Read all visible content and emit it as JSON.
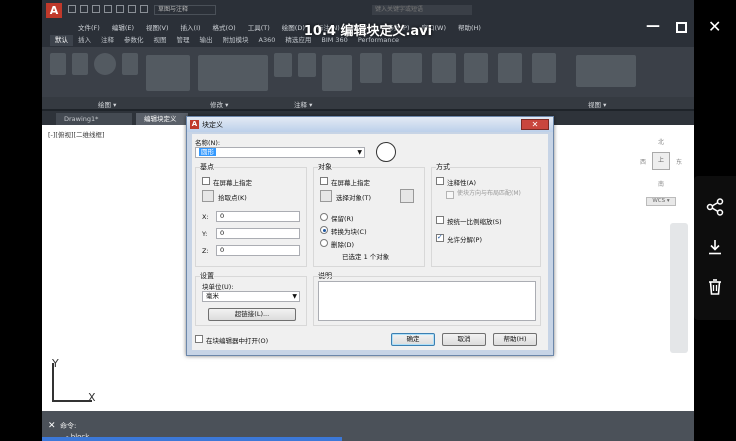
{
  "player": {
    "title": "10.4 编辑块定义.avi",
    "minimize_icon": "minimize-icon",
    "maximize_icon": "maximize-icon",
    "close_icon": "close-icon",
    "side_actions": [
      "share-icon",
      "download-icon",
      "delete-icon"
    ]
  },
  "autocad": {
    "logo": "A",
    "workspace": "草图与注释",
    "search_placeholder": "键入关键字或短语",
    "menu": [
      "文件(F)",
      "编辑(E)",
      "视图(V)",
      "插入(I)",
      "格式(O)",
      "工具(T)",
      "绘图(D)",
      "标注(N)",
      "修改(M)",
      "参数(P)",
      "窗口(W)",
      "帮助(H)"
    ],
    "ribbon_tabs": [
      "默认",
      "插入",
      "注释",
      "参数化",
      "视图",
      "管理",
      "输出",
      "附加模块",
      "A360",
      "精选应用",
      "BIM 360",
      "Performance"
    ],
    "ribbon_panels": [
      "绘图 ▾",
      "修改 ▾",
      "注释 ▾",
      "视图 ▾"
    ],
    "doc_tabs": [
      "Drawing1*",
      "编辑块定义"
    ],
    "view_label": "[-][俯视][二维线框]",
    "viewcube": {
      "north": "北",
      "west": "西",
      "east": "东",
      "south": "南",
      "top": "上",
      "wcs": "WCS ▾"
    },
    "ucs": {
      "x": "X",
      "y": "Y"
    },
    "command": {
      "prompt": "命令:",
      "text": "- block"
    }
  },
  "dialog": {
    "title": "块定义",
    "name_label": "名称(N):",
    "name_value": "圆形",
    "basepoint": {
      "title": "基点",
      "specify_on_screen": "在屏幕上指定",
      "pick_point": "拾取点(K)",
      "x_label": "X:",
      "x_value": "0",
      "y_label": "Y:",
      "y_value": "0",
      "z_label": "Z:",
      "z_value": "0"
    },
    "objects": {
      "title": "对象",
      "specify_on_screen": "在屏幕上指定",
      "select_objects": "选择对象(T)",
      "retain": "保留(R)",
      "convert": "转换为块(C)",
      "delete": "删除(D)",
      "selected_count": "已选定 1 个对象"
    },
    "behavior": {
      "title": "方式",
      "annotative": "注释性(A)",
      "match_orientation": "使块方向与布局匹配(M)",
      "scale_uniformly": "按统一比例缩放(S)",
      "allow_explode": "允许分解(P)"
    },
    "settings": {
      "title": "设置",
      "block_unit_label": "块单位(U):",
      "block_unit_value": "毫米",
      "hyperlink": "超链接(L)..."
    },
    "description": {
      "title": "说明",
      "value": ""
    },
    "open_in_editor": "在块编辑器中打开(O)",
    "ok": "确定",
    "cancel": "取消",
    "help": "帮助(H)",
    "close_symbol": "✕"
  }
}
